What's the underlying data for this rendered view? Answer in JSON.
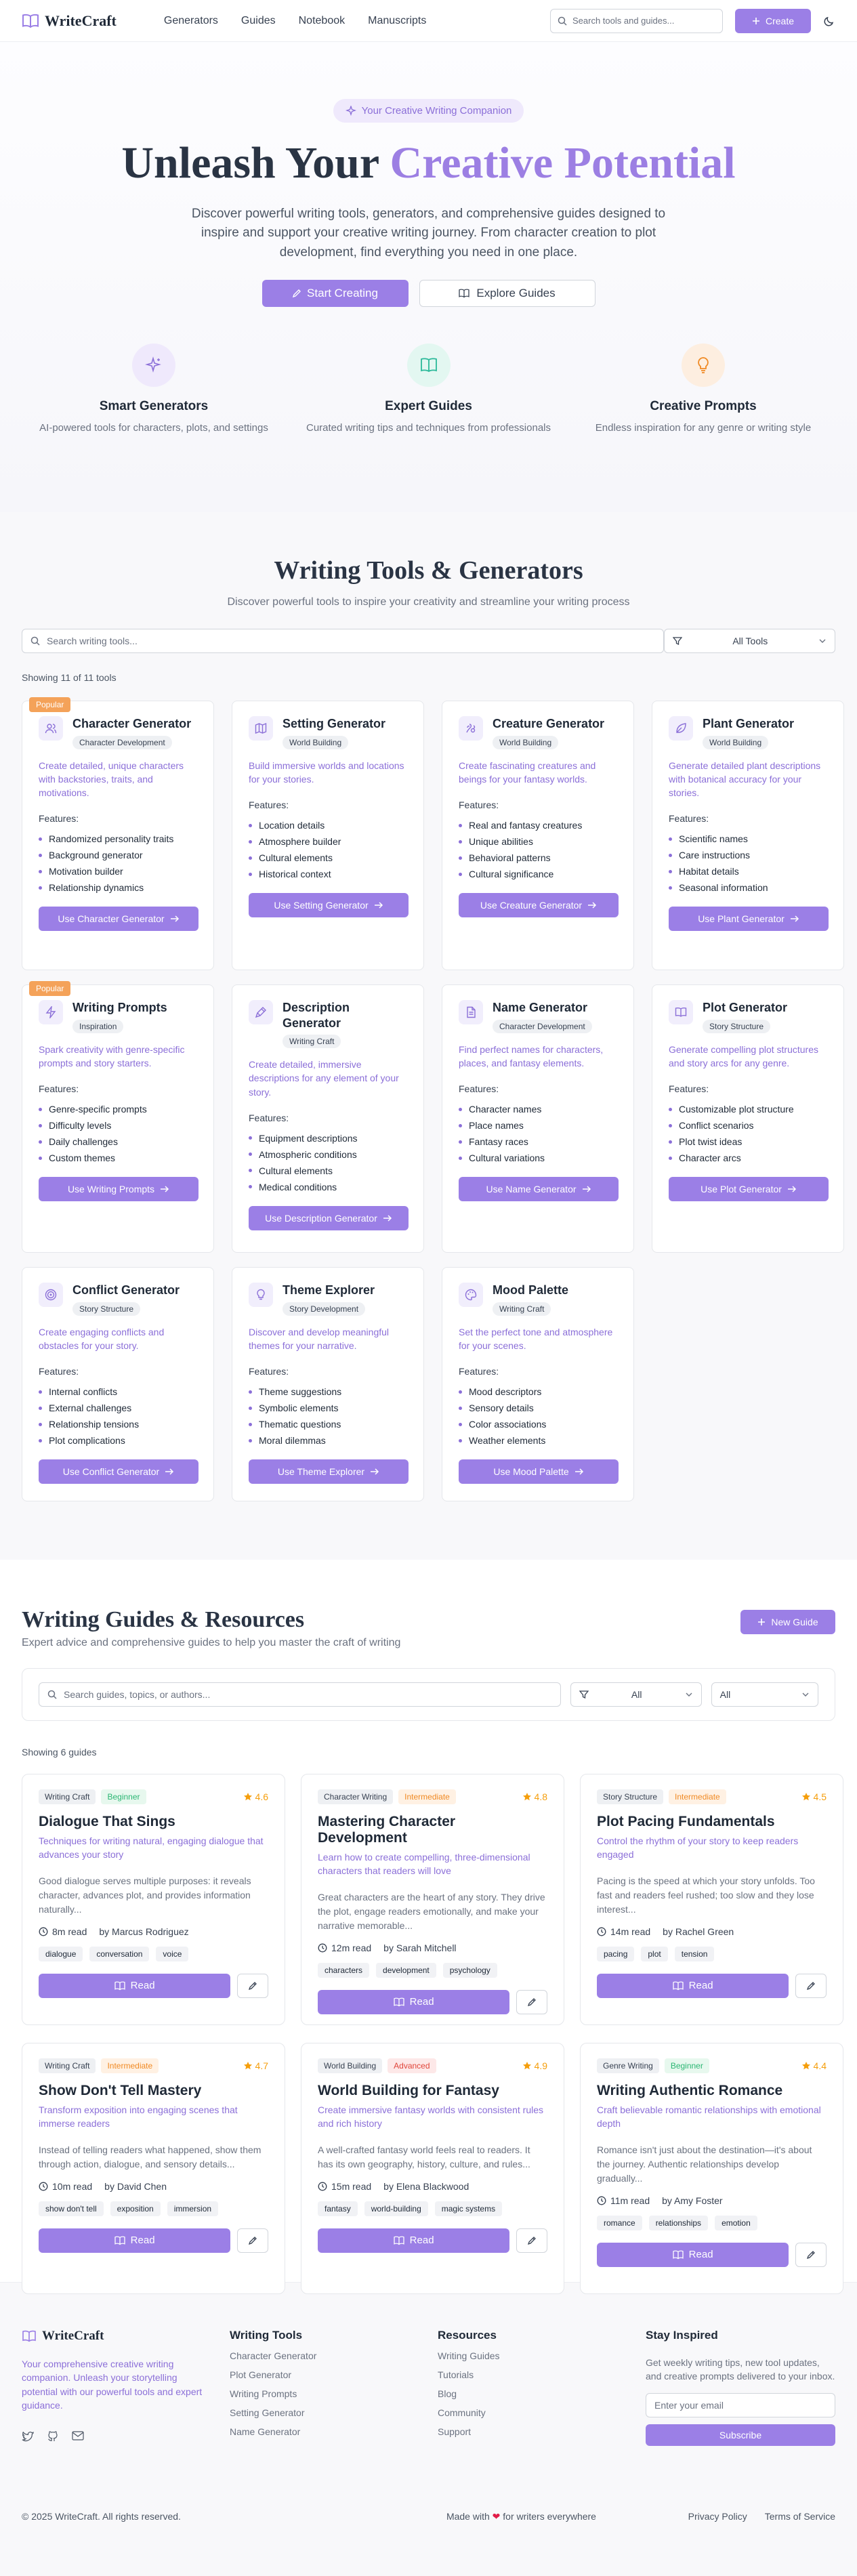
{
  "header": {
    "brand": "WriteCraft",
    "nav": [
      "Generators",
      "Guides",
      "Notebook",
      "Manuscripts"
    ],
    "search_placeholder": "Search tools and guides...",
    "create_label": "Create"
  },
  "hero": {
    "pill": "Your Creative Writing Companion",
    "title_a": "Unleash Your",
    "title_b": "Creative Potential",
    "paragraph": "Discover powerful writing tools, generators, and comprehensive guides designed to inspire and support your creative writing journey. From character creation to plot development, find everything you need in one place.",
    "primary_label": "Start Creating",
    "secondary_label": "Explore Guides",
    "features": [
      {
        "title": "Smart Generators",
        "text": "AI-powered tools for characters, plots, and settings",
        "icon": "sparkles-icon"
      },
      {
        "title": "Expert Guides",
        "text": "Curated writing tips and techniques from professionals",
        "icon": "book-icon"
      },
      {
        "title": "Creative Prompts",
        "text": "Endless inspiration for any genre or writing style",
        "icon": "lightbulb-icon"
      }
    ]
  },
  "tools": {
    "title": "Writing Tools & Generators",
    "subtitle": "Discover powerful tools to inspire your creativity and streamline your writing process",
    "search_placeholder": "Search writing tools...",
    "filter_value": "All Tools",
    "count": "Showing 11 of 11 tools",
    "features_label": "Features:",
    "popular_label": "Popular",
    "cards": [
      {
        "title": "Character Generator",
        "tag": "Character Development",
        "popular": true,
        "desc": "Create detailed, unique characters with backstories, traits, and motivations.",
        "features": [
          "Randomized personality traits",
          "Background generator",
          "Motivation builder",
          "Relationship dynamics"
        ],
        "button": "Use Character Generator",
        "icon": "users-icon"
      },
      {
        "title": "Setting Generator",
        "tag": "World Building",
        "popular": false,
        "desc": "Build immersive worlds and locations for your stories.",
        "features": [
          "Location details",
          "Atmosphere builder",
          "Cultural elements",
          "Historical context"
        ],
        "button": "Use Setting Generator",
        "icon": "map-icon"
      },
      {
        "title": "Creature Generator",
        "tag": "World Building",
        "popular": false,
        "desc": "Create fascinating creatures and beings for your fantasy worlds.",
        "features": [
          "Real and fantasy creatures",
          "Unique abilities",
          "Behavioral patterns",
          "Cultural significance"
        ],
        "button": "Use Creature Generator",
        "icon": "paw-icon"
      },
      {
        "title": "Plant Generator",
        "tag": "World Building",
        "popular": false,
        "desc": "Generate detailed plant descriptions with botanical accuracy for your stories.",
        "features": [
          "Scientific names",
          "Care instructions",
          "Habitat details",
          "Seasonal information"
        ],
        "button": "Use Plant Generator",
        "icon": "leaf-icon"
      },
      {
        "title": "Writing Prompts",
        "tag": "Inspiration",
        "popular": true,
        "desc": "Spark creativity with genre-specific prompts and story starters.",
        "features": [
          "Genre-specific prompts",
          "Difficulty levels",
          "Daily challenges",
          "Custom themes"
        ],
        "button": "Use Writing Prompts",
        "icon": "bolt-icon"
      },
      {
        "title": "Description Generator",
        "tag": "Writing Craft",
        "popular": false,
        "desc": "Create detailed, immersive descriptions for any element of your story.",
        "features": [
          "Equipment descriptions",
          "Atmospheric conditions",
          "Cultural elements",
          "Medical conditions"
        ],
        "button": "Use Description Generator",
        "icon": "pen-icon"
      },
      {
        "title": "Name Generator",
        "tag": "Character Development",
        "popular": false,
        "desc": "Find perfect names for characters, places, and fantasy elements.",
        "features": [
          "Character names",
          "Place names",
          "Fantasy races",
          "Cultural variations"
        ],
        "button": "Use Name Generator",
        "icon": "document-icon"
      },
      {
        "title": "Plot Generator",
        "tag": "Story Structure",
        "popular": false,
        "desc": "Generate compelling plot structures and story arcs for any genre.",
        "features": [
          "Customizable plot structure",
          "Conflict scenarios",
          "Plot twist ideas",
          "Character arcs"
        ],
        "button": "Use Plot Generator",
        "icon": "book-open-icon"
      },
      {
        "title": "Conflict Generator",
        "tag": "Story Structure",
        "popular": false,
        "desc": "Create engaging conflicts and obstacles for your story.",
        "features": [
          "Internal conflicts",
          "External challenges",
          "Relationship tensions",
          "Plot complications"
        ],
        "button": "Use Conflict Generator",
        "icon": "target-icon"
      },
      {
        "title": "Theme Explorer",
        "tag": "Story Development",
        "popular": false,
        "desc": "Discover and develop meaningful themes for your narrative.",
        "features": [
          "Theme suggestions",
          "Symbolic elements",
          "Thematic questions",
          "Moral dilemmas"
        ],
        "button": "Use Theme Explorer",
        "icon": "lightbulb-icon"
      },
      {
        "title": "Mood Palette",
        "tag": "Writing Craft",
        "popular": false,
        "desc": "Set the perfect tone and atmosphere for your scenes.",
        "features": [
          "Mood descriptors",
          "Sensory details",
          "Color associations",
          "Weather elements"
        ],
        "button": "Use Mood Palette",
        "icon": "palette-icon"
      }
    ]
  },
  "guides": {
    "title": "Writing Guides & Resources",
    "subtitle": "Expert advice and comprehensive guides to help you master the craft of writing",
    "new_label": "New Guide",
    "search_placeholder": "Search guides, topics, or authors...",
    "filter_a": "All",
    "filter_b": "All",
    "count": "Showing 6 guides",
    "read_label": "Read",
    "cards": [
      {
        "category": "Writing Craft",
        "level": "Beginner",
        "level_class": "beg",
        "rating": "4.6",
        "title": "Dialogue That Sings",
        "summary": "Techniques for writing natural, engaging dialogue that advances your story",
        "excerpt": "Good dialogue serves multiple purposes: it reveals character, advances plot, and provides information naturally...",
        "time": "8m read",
        "author": "by Marcus Rodriguez",
        "keywords": [
          "dialogue",
          "conversation",
          "voice"
        ]
      },
      {
        "category": "Character Writing",
        "level": "Intermediate",
        "level_class": "int",
        "rating": "4.8",
        "title": "Mastering Character Development",
        "summary": "Learn how to create compelling, three-dimensional characters that readers will love",
        "excerpt": "Great characters are the heart of any story. They drive the plot, engage readers emotionally, and make your narrative memorable...",
        "time": "12m read",
        "author": "by Sarah Mitchell",
        "keywords": [
          "characters",
          "development",
          "psychology"
        ]
      },
      {
        "category": "Story Structure",
        "level": "Intermediate",
        "level_class": "int",
        "rating": "4.5",
        "title": "Plot Pacing Fundamentals",
        "summary": "Control the rhythm of your story to keep readers engaged",
        "excerpt": "Pacing is the speed at which your story unfolds. Too fast and readers feel rushed; too slow and they lose interest...",
        "time": "14m read",
        "author": "by Rachel Green",
        "keywords": [
          "pacing",
          "plot",
          "tension"
        ]
      },
      {
        "category": "Writing Craft",
        "level": "Intermediate",
        "level_class": "int",
        "rating": "4.7",
        "title": "Show Don't Tell Mastery",
        "summary": "Transform exposition into engaging scenes that immerse readers",
        "excerpt": "Instead of telling readers what happened, show them through action, dialogue, and sensory details...",
        "time": "10m read",
        "author": "by David Chen",
        "keywords": [
          "show don't tell",
          "exposition",
          "immersion"
        ]
      },
      {
        "category": "World Building",
        "level": "Advanced",
        "level_class": "adv",
        "rating": "4.9",
        "title": "World Building for Fantasy",
        "summary": "Create immersive fantasy worlds with consistent rules and rich history",
        "excerpt": "A well-crafted fantasy world feels real to readers. It has its own geography, history, culture, and rules...",
        "time": "15m read",
        "author": "by Elena Blackwood",
        "keywords": [
          "fantasy",
          "world-building",
          "magic systems"
        ]
      },
      {
        "category": "Genre Writing",
        "level": "Beginner",
        "level_class": "beg",
        "rating": "4.4",
        "title": "Writing Authentic Romance",
        "summary": "Craft believable romantic relationships with emotional depth",
        "excerpt": "Romance isn't just about the destination—it's about the journey. Authentic relationships develop gradually...",
        "time": "11m read",
        "author": "by Amy Foster",
        "keywords": [
          "romance",
          "relationships",
          "emotion"
        ]
      }
    ]
  },
  "footer": {
    "brand": "WriteCraft",
    "desc": "Your comprehensive creative writing companion. Unleash your storytelling potential with our powerful tools and expert guidance.",
    "tools_title": "Writing Tools",
    "tools_links": [
      "Character Generator",
      "Plot Generator",
      "Writing Prompts",
      "Setting Generator",
      "Name Generator"
    ],
    "res_title": "Resources",
    "res_links": [
      "Writing Guides",
      "Tutorials",
      "Blog",
      "Community",
      "Support"
    ],
    "nl_title": "Stay Inspired",
    "nl_text": "Get weekly writing tips, new tool updates, and creative prompts delivered to your inbox.",
    "nl_placeholder": "Enter your email",
    "nl_button": "Subscribe",
    "copyright": "© 2025 WriteCraft. All rights reserved.",
    "made_a": "Made with",
    "made_b": "for writers everywhere",
    "privacy": "Privacy Policy",
    "terms": "Terms of Service"
  },
  "colors": {
    "accent": "#9b7fe6",
    "heading": "#2a3444",
    "popular": "#f4a259",
    "star": "#f59e0b"
  }
}
